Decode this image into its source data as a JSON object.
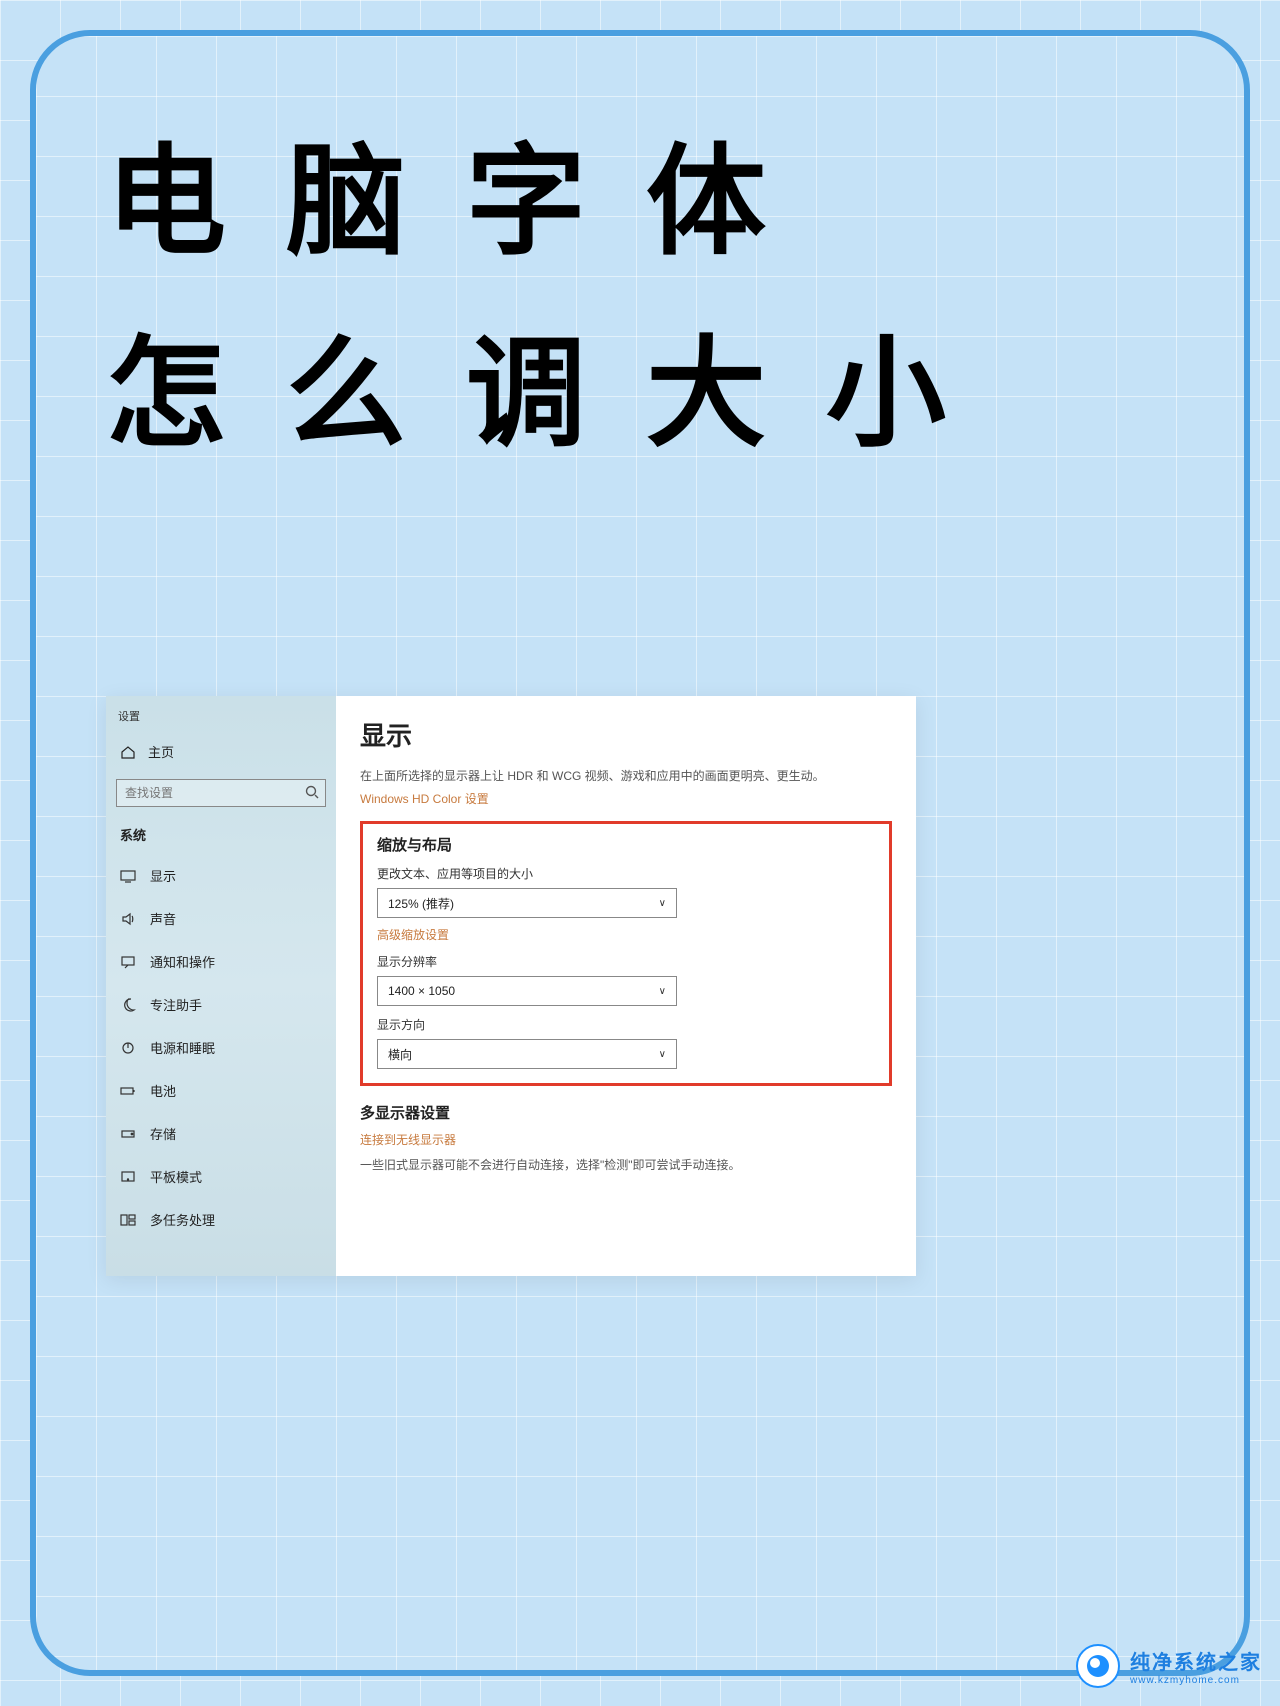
{
  "headline": {
    "line1": "电脑字体",
    "line2": "怎么调大小"
  },
  "settings": {
    "app_label": "设置",
    "home": "主页",
    "search_placeholder": "查找设置",
    "section": "系统",
    "nav": [
      "显示",
      "声音",
      "通知和操作",
      "专注助手",
      "电源和睡眠",
      "电池",
      "存储",
      "平板模式",
      "多任务处理"
    ]
  },
  "content": {
    "title": "显示",
    "hdr_desc": "在上面所选择的显示器上让 HDR 和 WCG 视频、游戏和应用中的画面更明亮、更生动。",
    "hdr_link": "Windows HD Color 设置",
    "scale_heading": "缩放与布局",
    "scale_label": "更改文本、应用等项目的大小",
    "scale_value": "125% (推荐)",
    "adv_scale": "高级缩放设置",
    "res_label": "显示分辨率",
    "res_value": "1400 × 1050",
    "orient_label": "显示方向",
    "orient_value": "横向",
    "multi_heading": "多显示器设置",
    "wireless": "连接到无线显示器",
    "detect_desc": "一些旧式显示器可能不会进行自动连接，选择\"检测\"即可尝试手动连接。"
  },
  "watermark": {
    "cn": "纯净系统之家",
    "en": "www.kzmyhome.com"
  }
}
